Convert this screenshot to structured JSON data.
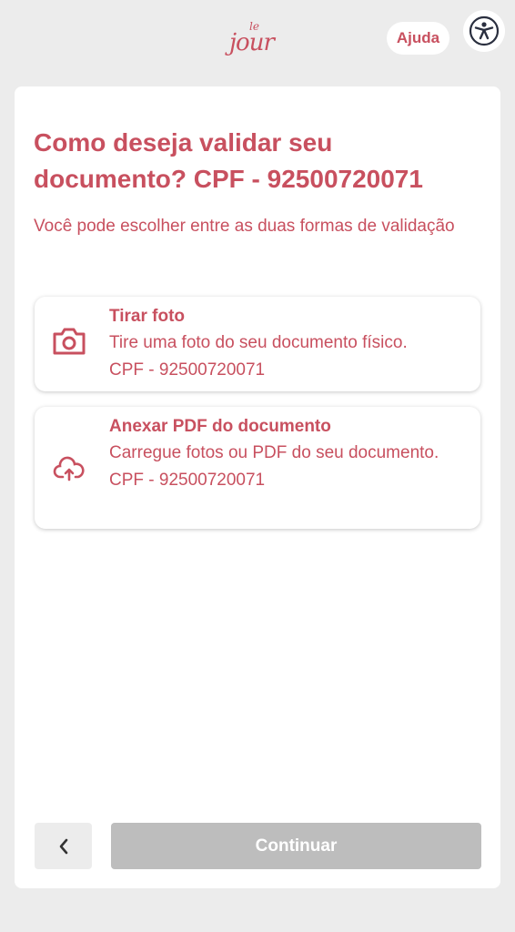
{
  "header": {
    "logo_small": "le",
    "logo_main": "jour",
    "help_label": "Ajuda",
    "accessibility_icon": "accessibility-icon"
  },
  "main": {
    "title": "Como deseja validar seu documento? CPF - 92500720071",
    "subtitle": "Você pode escolher entre as duas formas de validação",
    "options": [
      {
        "icon": "camera-icon",
        "title": "Tirar foto",
        "description": "Tire uma foto do seu documento físico.",
        "cpf": "CPF -  92500720071"
      },
      {
        "icon": "cloud-upload-icon",
        "title": "Anexar PDF do documento",
        "description": "Carregue fotos ou PDF do seu documento.",
        "cpf": "CPF -  92500720071"
      }
    ]
  },
  "footer": {
    "back_icon": "chevron-left-icon",
    "continue_label": "Continuar"
  },
  "colors": {
    "accent": "#c8505f",
    "background": "#ececec",
    "disabled_button": "#bdbdbd"
  }
}
